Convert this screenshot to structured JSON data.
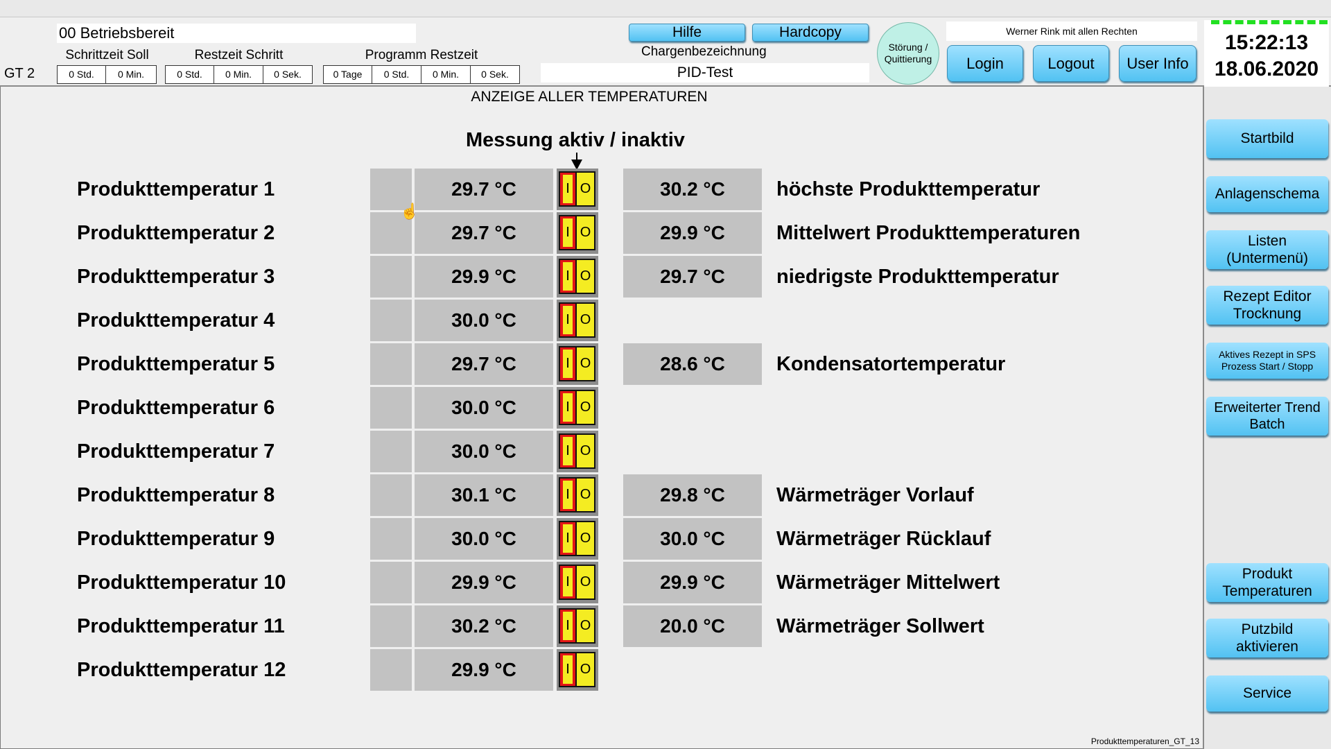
{
  "header": {
    "status": "00 Betriebsbereit",
    "unit": "GT 2",
    "schrittzeit_soll": {
      "label": "Schrittzeit Soll",
      "values": [
        "0 Std.",
        "0 Min."
      ]
    },
    "restzeit_schritt": {
      "label": "Restzeit Schritt",
      "values": [
        "0 Std.",
        "0 Min.",
        "0 Sek."
      ]
    },
    "programm_restzeit": {
      "label": "Programm Restzeit",
      "values": [
        "0 Tage",
        "0 Std.",
        "0 Min.",
        "0 Sek."
      ]
    },
    "hilfe": "Hilfe",
    "hardcopy": "Hardcopy",
    "charge_label": "Chargenbezeichnung",
    "charge_value": "PID-Test",
    "stoerung": "Störung /\nQuittierung",
    "user_text": "Werner Rink mit allen Rechten",
    "login": "Login",
    "logout": "Logout",
    "user_info": "User Info",
    "time": "15:22:13",
    "date": "18.06.2020"
  },
  "main": {
    "title": "ANZEIGE ALLER TEMPERATUREN",
    "measure_header": "Messung aktiv / inaktiv",
    "toggle_on": "I",
    "toggle_off": "O",
    "products": [
      {
        "label": "Produkttemperatur 1",
        "value": "29.7 °C"
      },
      {
        "label": "Produkttemperatur 2",
        "value": "29.7 °C"
      },
      {
        "label": "Produkttemperatur 3",
        "value": "29.9 °C"
      },
      {
        "label": "Produkttemperatur 4",
        "value": "30.0 °C"
      },
      {
        "label": "Produkttemperatur 5",
        "value": "29.7 °C"
      },
      {
        "label": "Produkttemperatur 6",
        "value": "30.0 °C"
      },
      {
        "label": "Produkttemperatur 7",
        "value": "30.0 °C"
      },
      {
        "label": "Produkttemperatur 8",
        "value": "30.1 °C"
      },
      {
        "label": "Produkttemperatur 9",
        "value": "30.0 °C"
      },
      {
        "label": "Produkttemperatur 10",
        "value": "29.9 °C"
      },
      {
        "label": "Produkttemperatur 11",
        "value": "30.2 °C"
      },
      {
        "label": "Produkttemperatur 12",
        "value": "29.9 °C"
      }
    ],
    "summary": [
      {
        "value": "30.2 °C",
        "label": "höchste Produkttemperatur"
      },
      {
        "value": "29.9 °C",
        "label": "Mittelwert Produkttemperaturen"
      },
      {
        "value": "29.7 °C",
        "label": "niedrigste Produkttemperatur"
      },
      {
        "value": "28.6 °C",
        "label": "Kondensatortemperatur"
      },
      {
        "value": "29.8 °C",
        "label": "Wärmeträger Vorlauf"
      },
      {
        "value": "30.0 °C",
        "label": "Wärmeträger Rücklauf"
      },
      {
        "value": "29.9 °C",
        "label": "Wärmeträger Mittelwert"
      },
      {
        "value": "20.0 °C",
        "label": "Wärmeträger Sollwert"
      }
    ]
  },
  "sidebar": {
    "startbild": "Startbild",
    "anlagenschema": "Anlagenschema",
    "listen": "Listen\n(Untermenü)",
    "rezept_editor": "Rezept Editor\nTrocknung",
    "aktives_rezept": "Aktives Rezept in SPS\nProzess Start / Stopp",
    "trend": "Erweiterter Trend\nBatch",
    "produkt_temp": "Produkt\nTemperaturen",
    "putzbild": "Putzbild\naktivieren",
    "service": "Service"
  },
  "footer": {
    "screen_id": "Produkttemperaturen_GT_13"
  }
}
